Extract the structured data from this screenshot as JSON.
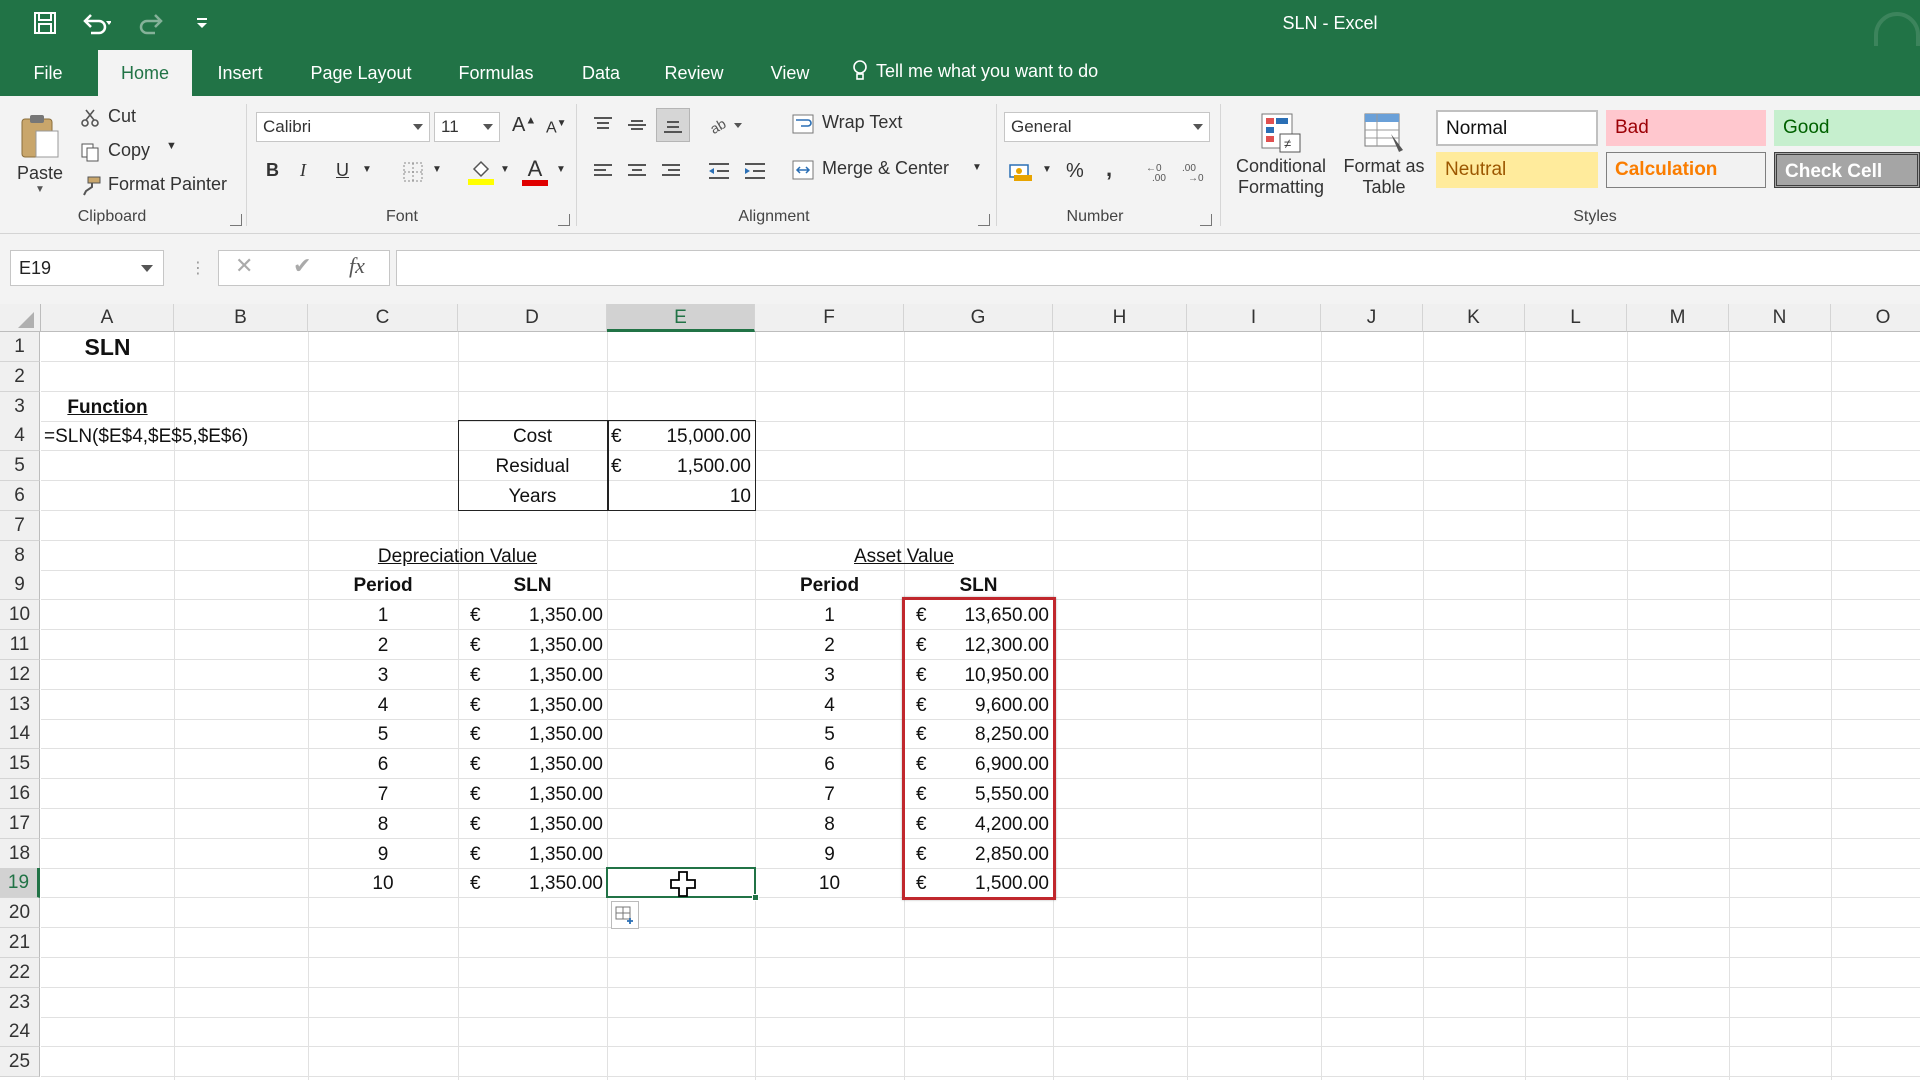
{
  "window": {
    "title": "SLN - Excel"
  },
  "ribbon_tabs": [
    "File",
    "Home",
    "Insert",
    "Page Layout",
    "Formulas",
    "Data",
    "Review",
    "View"
  ],
  "tell_me": "Tell me what you want to do",
  "clipboard": {
    "paste": "Paste",
    "cut": "Cut",
    "copy": "Copy",
    "format_painter": "Format Painter",
    "label": "Clipboard"
  },
  "font": {
    "name": "Calibri",
    "size": "11",
    "bold": "B",
    "italic": "I",
    "underline": "U",
    "label": "Font"
  },
  "alignment": {
    "wrap_text": "Wrap Text",
    "merge_center": "Merge & Center",
    "label": "Alignment"
  },
  "number": {
    "format": "General",
    "percent": "%",
    "comma": ",",
    "label": "Number"
  },
  "styles": {
    "conditional_1": "Conditional",
    "conditional_2": "Formatting",
    "format_table_1": "Format as",
    "format_table_2": "Table",
    "normal": "Normal",
    "bad": "Bad",
    "good": "Good",
    "neutral": "Neutral",
    "calculation": "Calculation",
    "check_cell": "Check Cell",
    "label": "Styles",
    "colors": {
      "bad_bg": "#ffc7ce",
      "bad_fg": "#9c0006",
      "good_bg": "#c6efce",
      "good_fg": "#006100",
      "neutral_bg": "#ffeb9c",
      "neutral_fg": "#9c5700",
      "calc_bg": "#f2f2f2",
      "calc_fg": "#fa7d00",
      "check_bg": "#a5a5a5"
    }
  },
  "formula_bar": {
    "name_box": "E19",
    "cancel": "✕",
    "enter": "✔",
    "fx": "fx",
    "formula": ""
  },
  "columns": [
    "A",
    "B",
    "C",
    "D",
    "E",
    "F",
    "G",
    "H",
    "I",
    "J",
    "K",
    "L",
    "M",
    "N",
    "O"
  ],
  "selected_column": "E",
  "rows": [
    "1",
    "2",
    "3",
    "4",
    "5",
    "6",
    "7",
    "8",
    "9",
    "10",
    "11",
    "12",
    "13",
    "14",
    "15",
    "16",
    "17",
    "18",
    "19",
    "20",
    "21",
    "22",
    "23",
    "24",
    "25"
  ],
  "selected_row": "19",
  "sheet": {
    "a1": "SLN",
    "a3": "Function",
    "a4": "=SLN($E$4,$E$5,$E$6)",
    "inputs": [
      {
        "label": "Cost",
        "currency": "€",
        "value": "15,000.00"
      },
      {
        "label": "Residual",
        "currency": "€",
        "value": "1,500.00"
      },
      {
        "label": "Years",
        "currency": "",
        "value": "10"
      }
    ],
    "depreciation_title": "Depreciation Value",
    "asset_title": "Asset Value",
    "period_header": "Period",
    "sln_header": "SLN",
    "currency": "€",
    "depreciation": [
      {
        "period": "1",
        "value": "1,350.00"
      },
      {
        "period": "2",
        "value": "1,350.00"
      },
      {
        "period": "3",
        "value": "1,350.00"
      },
      {
        "period": "4",
        "value": "1,350.00"
      },
      {
        "period": "5",
        "value": "1,350.00"
      },
      {
        "period": "6",
        "value": "1,350.00"
      },
      {
        "period": "7",
        "value": "1,350.00"
      },
      {
        "period": "8",
        "value": "1,350.00"
      },
      {
        "period": "9",
        "value": "1,350.00"
      },
      {
        "period": "10",
        "value": "1,350.00"
      }
    ],
    "asset": [
      {
        "period": "1",
        "value": "13,650.00"
      },
      {
        "period": "2",
        "value": "12,300.00"
      },
      {
        "period": "3",
        "value": "10,950.00"
      },
      {
        "period": "4",
        "value": "9,600.00"
      },
      {
        "period": "5",
        "value": "8,250.00"
      },
      {
        "period": "6",
        "value": "6,900.00"
      },
      {
        "period": "7",
        "value": "5,550.00"
      },
      {
        "period": "8",
        "value": "4,200.00"
      },
      {
        "period": "9",
        "value": "2,850.00"
      },
      {
        "period": "10",
        "value": "1,500.00"
      }
    ],
    "highlight_color": "#c0272d"
  },
  "theme": {
    "excel_green": "#217346"
  }
}
